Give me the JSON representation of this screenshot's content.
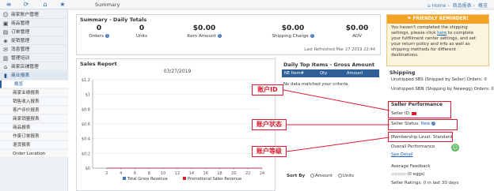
{
  "topbar": {
    "icons": [
      "menu-icon",
      "refresh-icon",
      "home-icon",
      "star-icon"
    ],
    "title": "Summary",
    "breadcrumb": [
      "Home",
      "商品报表",
      "概览"
    ]
  },
  "sidebar": {
    "items": [
      {
        "label": "商家账户管理",
        "icon": "user-icon"
      },
      {
        "label": "商品管理",
        "icon": "box-icon"
      },
      {
        "label": "订单管理",
        "icon": "order-icon"
      },
      {
        "label": "促销管理",
        "icon": "tag-icon"
      },
      {
        "label": "消息管理",
        "icon": "mail-icon"
      },
      {
        "label": "管理培训",
        "icon": "book-icon"
      },
      {
        "label": "商家店铺管理",
        "icon": "store-icon"
      },
      {
        "label": "商业报表",
        "icon": "chart-icon"
      }
    ],
    "subitems": [
      "概览",
      "商家业绩报表",
      "销售收入报表",
      "客户评价报表",
      "商家销量报表",
      "商品报表",
      "作废订单报表",
      "退货报表",
      "Order Location"
    ]
  },
  "totals": {
    "title": "Summary - Daily Totals",
    "items": [
      {
        "value": "0",
        "label": "Orders",
        "help": true
      },
      {
        "value": "0",
        "label": "Units",
        "help": false
      },
      {
        "value": "$0.00",
        "label": "Item Amount",
        "help": true
      },
      {
        "value": "$0.00",
        "label": "Shipping Charge",
        "help": true
      },
      {
        "value": "$0.00",
        "label": "AOV",
        "help": false
      }
    ],
    "last_refreshed": "Last Refreshed:Mar 27 2019 22:44"
  },
  "sales": {
    "title": "Sales Report"
  },
  "chart_data": {
    "type": "line",
    "title": "03/27/2019",
    "x": [
      2,
      4,
      6,
      8,
      10,
      12,
      14,
      16,
      18,
      20,
      22,
      24
    ],
    "yticks": [
      "$0",
      "$0.2",
      "$0.4",
      "$0.6",
      "$0.8",
      "$1",
      "$1.2"
    ],
    "ylim": [
      0,
      1.2
    ],
    "series": [
      {
        "name": "Total Gross Revenue",
        "values": [
          0,
          0,
          0,
          0,
          0,
          0,
          0,
          0,
          0,
          0,
          0,
          0
        ],
        "color": "#3d74b9"
      },
      {
        "name": "Promotional Sales Revenue",
        "values": [
          0,
          0,
          0,
          0,
          0,
          0,
          0,
          0,
          0,
          0,
          0,
          0
        ],
        "color": "#e0192f"
      }
    ],
    "grid": true,
    "legend": "bottom"
  },
  "topitems": {
    "title": "Daily Top Items - Gross Amount",
    "columns": [
      "NE Item#",
      "Qty",
      "Amount"
    ],
    "no_data": "No data matched your criteria.",
    "sort_label": "Sort By",
    "sort_options": [
      "Amount",
      "Units"
    ]
  },
  "reminder": {
    "title": "FRIENDLY REMINDER!",
    "text_before": "You haven't completed the shipping settings, please click ",
    "link": "here",
    "text_after": " to complete your fulfillment center settings, and set your return policy and info as well as shipping methods for different destinations."
  },
  "shipping": {
    "title": "Shipping",
    "sbs": "Unshipped SBS (Shipped by Seller) Orders: 0",
    "sbn": "Unshipped SBN (Shipping by Newegg) Orders: 0"
  },
  "performance": {
    "title": "Seller Performance",
    "seller_id_label": "Seller ID:",
    "status_label": "Seller Status:",
    "status_value": "New",
    "membership": "Membership Level:  Standard",
    "overall_label": "Overall Performance",
    "see_detail": "See Detail",
    "avg_feedback": "Average Feedback",
    "feedback_value": "(0 eggs)",
    "ratings": "Seller Ratings: 0 in last 30 days"
  },
  "annotations": {
    "seller_id": "账户ID",
    "status": "账户状态",
    "level": "账户等级"
  },
  "colors": {
    "accent": "#2f5f96",
    "reminder": "#f3a223",
    "annotation": "#e0192f",
    "good": "#5cb85c"
  }
}
